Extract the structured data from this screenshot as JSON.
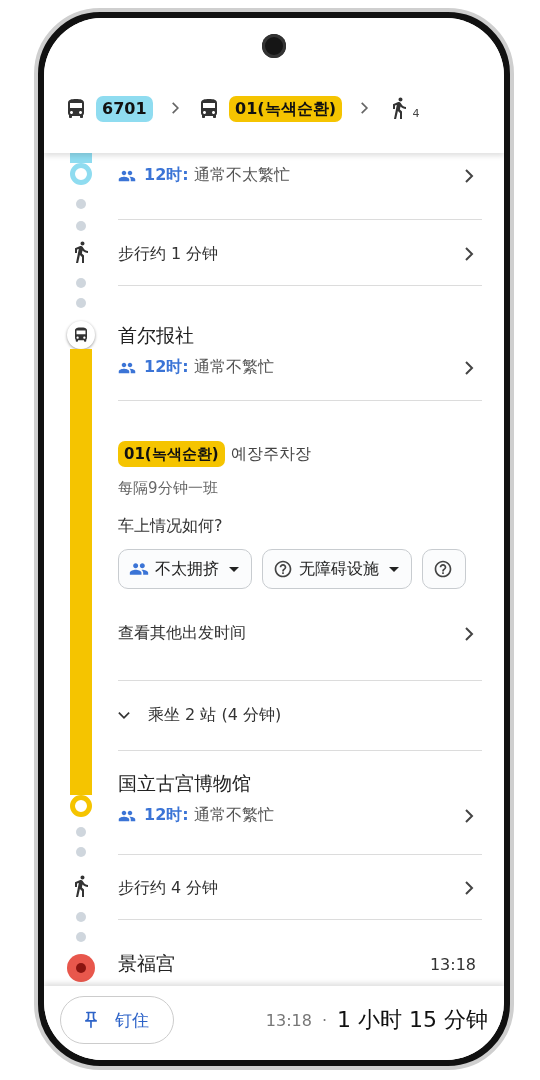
{
  "header": {
    "legs": [
      {
        "kind": "bus",
        "label": "6701",
        "color": "#8fdcf0"
      },
      {
        "kind": "bus",
        "label": "01(녹색순환)",
        "color": "#f5c400"
      },
      {
        "kind": "walk",
        "label": "4"
      }
    ]
  },
  "timeline": [
    {
      "kind": "partial_stop",
      "color": "#8fdcf0",
      "crowd_time": "12时:",
      "crowd_text": "通常不太繁忙"
    },
    {
      "kind": "walk",
      "text": "步行约 1 分钟"
    },
    {
      "kind": "board_stop",
      "color": "#f5c400",
      "name": "首尔报社",
      "crowd_time": "12时:",
      "crowd_text": "通常不繁忙"
    },
    {
      "kind": "ride",
      "color": "#f5c400",
      "route": "01(녹색순환)",
      "destination": "예장주차장",
      "frequency": "每隔9分钟一班",
      "question": "车上情况如何?",
      "chips": [
        {
          "kind": "crowd",
          "label": "不太拥挤"
        },
        {
          "kind": "help",
          "label": "无障碍设施"
        },
        {
          "kind": "help"
        }
      ],
      "departures": "查看其他出发时间"
    },
    {
      "kind": "stops",
      "color": "#f5c400",
      "text": "乘坐 2 站 (4 分钟)",
      "expanded": false
    },
    {
      "kind": "alight_stop",
      "color": "#f5c400",
      "name": "国立古宫博物馆",
      "crowd_time": "12时:",
      "crowd_text": "通常不繁忙"
    },
    {
      "kind": "walk",
      "text": "步行约 4 分钟"
    },
    {
      "kind": "destination",
      "name": "景福宫",
      "time": "13:18"
    }
  ],
  "footer": {
    "pin_label": "钉住",
    "arrival": "13:18",
    "separator": "·",
    "duration": "1 小时 15 分钟"
  }
}
